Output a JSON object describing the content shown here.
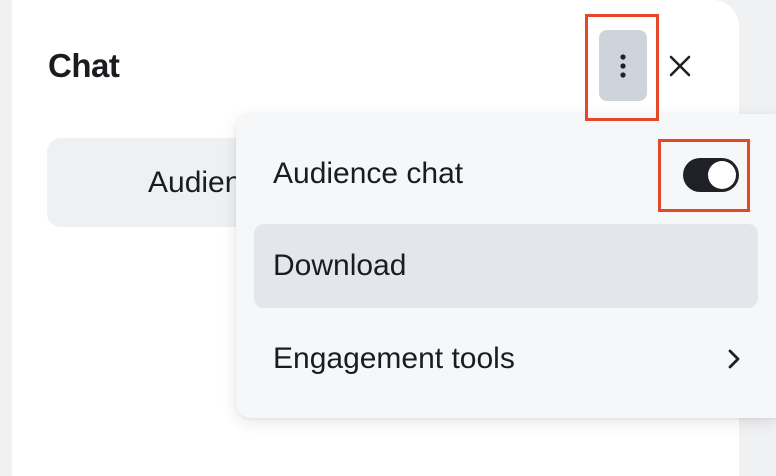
{
  "chat_panel": {
    "title": "Chat",
    "tab_label": "Audience chat"
  },
  "header": {
    "more_icon": "more-vertical-icon",
    "close_icon": "close-icon"
  },
  "menu": {
    "items": [
      {
        "label": "Audience chat",
        "control": "toggle",
        "toggle_on": true
      },
      {
        "label": "Download",
        "highlighted": true
      },
      {
        "label": "Engagement tools",
        "icon": "chevron-right-icon"
      }
    ]
  },
  "colors": {
    "annotation_box": "#e54828",
    "toggle_track": "#1f2126",
    "more_button_bg": "#cfd3db",
    "hovered_item_bg": "#e3e6ea"
  }
}
